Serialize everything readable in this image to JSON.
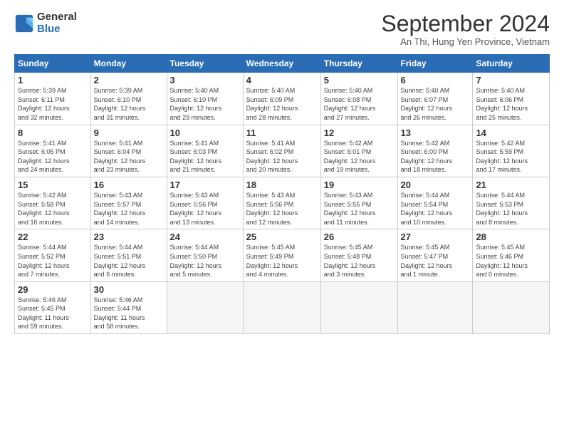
{
  "logo": {
    "general": "General",
    "blue": "Blue"
  },
  "header": {
    "month": "September 2024",
    "location": "An Thi, Hung Yen Province, Vietnam"
  },
  "weekdays": [
    "Sunday",
    "Monday",
    "Tuesday",
    "Wednesday",
    "Thursday",
    "Friday",
    "Saturday"
  ],
  "weeks": [
    [
      {
        "day": "1",
        "info": "Sunrise: 5:39 AM\nSunset: 6:11 PM\nDaylight: 12 hours\nand 32 minutes."
      },
      {
        "day": "2",
        "info": "Sunrise: 5:39 AM\nSunset: 6:10 PM\nDaylight: 12 hours\nand 31 minutes."
      },
      {
        "day": "3",
        "info": "Sunrise: 5:40 AM\nSunset: 6:10 PM\nDaylight: 12 hours\nand 29 minutes."
      },
      {
        "day": "4",
        "info": "Sunrise: 5:40 AM\nSunset: 6:09 PM\nDaylight: 12 hours\nand 28 minutes."
      },
      {
        "day": "5",
        "info": "Sunrise: 5:40 AM\nSunset: 6:08 PM\nDaylight: 12 hours\nand 27 minutes."
      },
      {
        "day": "6",
        "info": "Sunrise: 5:40 AM\nSunset: 6:07 PM\nDaylight: 12 hours\nand 26 minutes."
      },
      {
        "day": "7",
        "info": "Sunrise: 5:40 AM\nSunset: 6:06 PM\nDaylight: 12 hours\nand 25 minutes."
      }
    ],
    [
      {
        "day": "8",
        "info": "Sunrise: 5:41 AM\nSunset: 6:05 PM\nDaylight: 12 hours\nand 24 minutes."
      },
      {
        "day": "9",
        "info": "Sunrise: 5:41 AM\nSunset: 6:04 PM\nDaylight: 12 hours\nand 23 minutes."
      },
      {
        "day": "10",
        "info": "Sunrise: 5:41 AM\nSunset: 6:03 PM\nDaylight: 12 hours\nand 21 minutes."
      },
      {
        "day": "11",
        "info": "Sunrise: 5:41 AM\nSunset: 6:02 PM\nDaylight: 12 hours\nand 20 minutes."
      },
      {
        "day": "12",
        "info": "Sunrise: 5:42 AM\nSunset: 6:01 PM\nDaylight: 12 hours\nand 19 minutes."
      },
      {
        "day": "13",
        "info": "Sunrise: 5:42 AM\nSunset: 6:00 PM\nDaylight: 12 hours\nand 18 minutes."
      },
      {
        "day": "14",
        "info": "Sunrise: 5:42 AM\nSunset: 5:59 PM\nDaylight: 12 hours\nand 17 minutes."
      }
    ],
    [
      {
        "day": "15",
        "info": "Sunrise: 5:42 AM\nSunset: 5:58 PM\nDaylight: 12 hours\nand 16 minutes."
      },
      {
        "day": "16",
        "info": "Sunrise: 5:43 AM\nSunset: 5:57 PM\nDaylight: 12 hours\nand 14 minutes."
      },
      {
        "day": "17",
        "info": "Sunrise: 5:43 AM\nSunset: 5:56 PM\nDaylight: 12 hours\nand 13 minutes."
      },
      {
        "day": "18",
        "info": "Sunrise: 5:43 AM\nSunset: 5:56 PM\nDaylight: 12 hours\nand 12 minutes."
      },
      {
        "day": "19",
        "info": "Sunrise: 5:43 AM\nSunset: 5:55 PM\nDaylight: 12 hours\nand 11 minutes."
      },
      {
        "day": "20",
        "info": "Sunrise: 5:44 AM\nSunset: 5:54 PM\nDaylight: 12 hours\nand 10 minutes."
      },
      {
        "day": "21",
        "info": "Sunrise: 5:44 AM\nSunset: 5:53 PM\nDaylight: 12 hours\nand 8 minutes."
      }
    ],
    [
      {
        "day": "22",
        "info": "Sunrise: 5:44 AM\nSunset: 5:52 PM\nDaylight: 12 hours\nand 7 minutes."
      },
      {
        "day": "23",
        "info": "Sunrise: 5:44 AM\nSunset: 5:51 PM\nDaylight: 12 hours\nand 6 minutes."
      },
      {
        "day": "24",
        "info": "Sunrise: 5:44 AM\nSunset: 5:50 PM\nDaylight: 12 hours\nand 5 minutes."
      },
      {
        "day": "25",
        "info": "Sunrise: 5:45 AM\nSunset: 5:49 PM\nDaylight: 12 hours\nand 4 minutes."
      },
      {
        "day": "26",
        "info": "Sunrise: 5:45 AM\nSunset: 5:48 PM\nDaylight: 12 hours\nand 3 minutes."
      },
      {
        "day": "27",
        "info": "Sunrise: 5:45 AM\nSunset: 5:47 PM\nDaylight: 12 hours\nand 1 minute."
      },
      {
        "day": "28",
        "info": "Sunrise: 5:45 AM\nSunset: 5:46 PM\nDaylight: 12 hours\nand 0 minutes."
      }
    ],
    [
      {
        "day": "29",
        "info": "Sunrise: 5:46 AM\nSunset: 5:45 PM\nDaylight: 11 hours\nand 59 minutes."
      },
      {
        "day": "30",
        "info": "Sunrise: 5:46 AM\nSunset: 5:44 PM\nDaylight: 11 hours\nand 58 minutes."
      },
      {
        "day": "",
        "info": ""
      },
      {
        "day": "",
        "info": ""
      },
      {
        "day": "",
        "info": ""
      },
      {
        "day": "",
        "info": ""
      },
      {
        "day": "",
        "info": ""
      }
    ]
  ]
}
